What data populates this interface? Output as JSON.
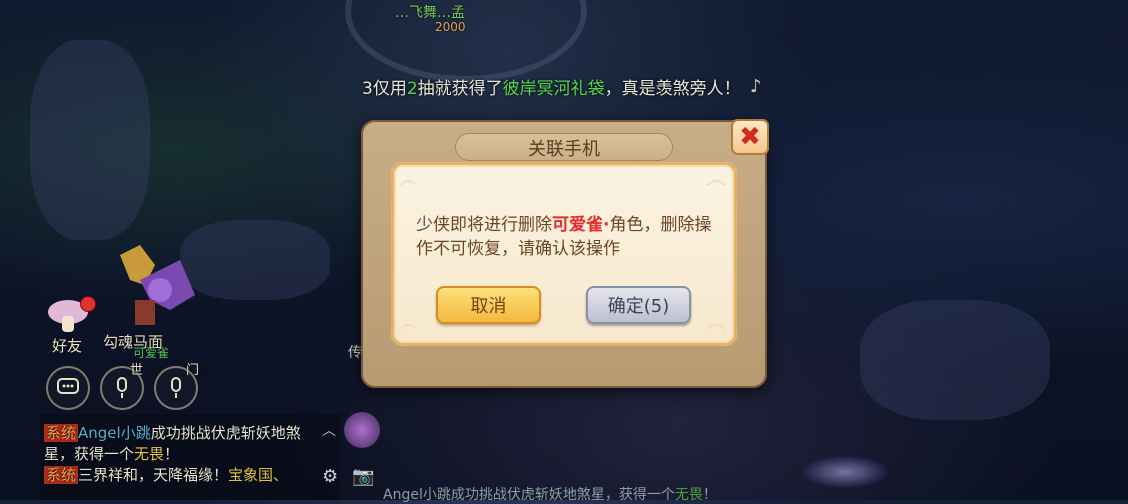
{
  "top": {
    "name": "…飞舞…孟",
    "sub": "2000"
  },
  "announcement": {
    "prefix": "3仅用",
    "count": "2",
    "mid": "抽就获得了",
    "item": "彼岸冥河礼袋",
    "suffix": "，真是羡煞旁人！"
  },
  "hud": {
    "friend_label": "好友",
    "npc_label": "勾魂马面",
    "npc_sub": "可爱雀",
    "world_label": "世",
    "gate_label": "门",
    "side_label": "传"
  },
  "chat": {
    "line1_tag": "系统",
    "line1_name": "Angel小跳",
    "line1_text": "成功挑战伏虎斩妖地煞",
    "line2_text": "星，获得一个",
    "line2_item": "无畏",
    "line2_end": "！",
    "line3_tag": "系统",
    "line3_text": "三界祥和，天降福缘！",
    "line3_place": "宝象国、"
  },
  "bottom_announce": {
    "text": "Angel小跳成功挑战伏虎斩妖地煞星，获得一个",
    "item": "无畏",
    "end": "！"
  },
  "dialog": {
    "title": "关联手机",
    "msg_prefix": "少侠即将进行删除",
    "role_name": "可爱雀",
    "msg_dot": "·",
    "msg_suffix": "角色，删除操作不可恢复，请确认该操作",
    "cancel_label": "取消",
    "confirm_label": "确定(5)",
    "close_symbol": "✖"
  },
  "icons": {
    "chat": "chat-bubble-icon",
    "voice": "microphone-icon",
    "close": "close-icon",
    "gear": "gear-icon",
    "camera": "camera-icon"
  },
  "colors": {
    "highlight_red": "#e52b2b",
    "cancel_gold": "#f3b63b",
    "confirm_grey": "#b9bdcd",
    "item_green": "#53d94b"
  }
}
